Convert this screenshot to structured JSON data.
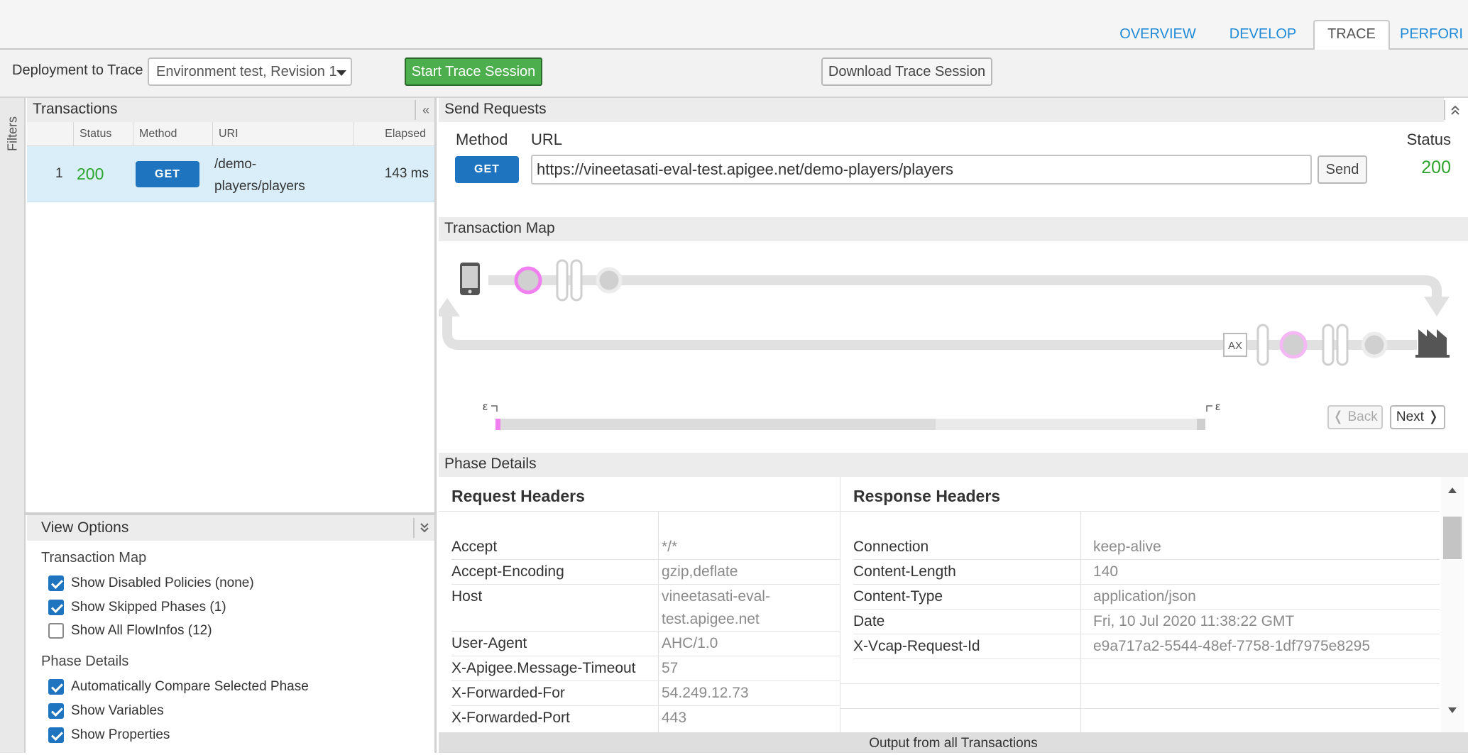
{
  "tabs": [
    {
      "label": "OVERVIEW",
      "active": false
    },
    {
      "label": "DEVELOP",
      "active": false
    },
    {
      "label": "TRACE",
      "active": true
    },
    {
      "label": "PERFORI",
      "active": false
    }
  ],
  "toolbar": {
    "deployment_label": "Deployment to Trace",
    "deployment_value": "Environment test, Revision 1",
    "start_button": "Start Trace Session",
    "download_button": "Download Trace Session"
  },
  "filters_label": "Filters",
  "transactions": {
    "title": "Transactions",
    "collapse_glyph": "«",
    "columns": [
      "Status",
      "Method",
      "URI",
      "Elapsed"
    ],
    "rows": [
      {
        "index": "1",
        "status": "200",
        "method": "GET",
        "uri_line1": "/demo-",
        "uri_line2": "players/players",
        "elapsed": "143 ms"
      }
    ]
  },
  "view_options": {
    "title": "View Options",
    "sections": [
      {
        "title": "Transaction Map",
        "items": [
          {
            "label": "Show Disabled Policies (none)",
            "checked": true
          },
          {
            "label": "Show Skipped Phases (1)",
            "checked": true
          },
          {
            "label": "Show All FlowInfos (12)",
            "checked": false
          }
        ]
      },
      {
        "title": "Phase Details",
        "items": [
          {
            "label": "Automatically Compare Selected Phase",
            "checked": true
          },
          {
            "label": "Show Variables",
            "checked": true
          },
          {
            "label": "Show Properties",
            "checked": true
          }
        ]
      }
    ]
  },
  "send_requests": {
    "title": "Send Requests",
    "method_label": "Method",
    "url_label": "URL",
    "status_label": "Status",
    "method": "GET",
    "url": "https://vineetasati-eval-test.apigee.net/demo-players/players",
    "send_button": "Send",
    "status": "200"
  },
  "transaction_map": {
    "title": "Transaction Map",
    "ax_label": "AX",
    "epsilon": "ε",
    "back_button": "❬ Back",
    "next_button": "Next ❭"
  },
  "phase_details": {
    "title": "Phase Details",
    "request_title": "Request Headers",
    "response_title": "Response Headers",
    "request_headers": [
      {
        "name": "Accept",
        "value": "*/*"
      },
      {
        "name": "Accept-Encoding",
        "value": "gzip,deflate"
      },
      {
        "name": "Host",
        "value": "vineetasati-eval-",
        "value2": "test.apigee.net"
      },
      {
        "name": "User-Agent",
        "value": "AHC/1.0"
      },
      {
        "name": "X-Apigee.Message-Timeout",
        "value": "57"
      },
      {
        "name": "X-Forwarded-For",
        "value": "54.249.12.73"
      },
      {
        "name": "X-Forwarded-Port",
        "value": "443"
      }
    ],
    "response_headers": [
      {
        "name": "Connection",
        "value": "keep-alive"
      },
      {
        "name": "Content-Length",
        "value": "140"
      },
      {
        "name": "Content-Type",
        "value": "application/json"
      },
      {
        "name": "Date",
        "value": "Fri, 10 Jul 2020 11:38:22 GMT"
      },
      {
        "name": "X-Vcap-Request-Id",
        "value": "e9a717a2-5544-48ef-7758-1df7975e8295"
      }
    ]
  },
  "output_label": "Output from all Transactions",
  "colors": {
    "link_blue": "#1e8ad6",
    "primary_blue": "#1f74bf",
    "start_green": "#4cae4c",
    "status_green": "#2ea52e",
    "policy_magenta": "#f080f0",
    "selected_row": "#d9eef9"
  }
}
